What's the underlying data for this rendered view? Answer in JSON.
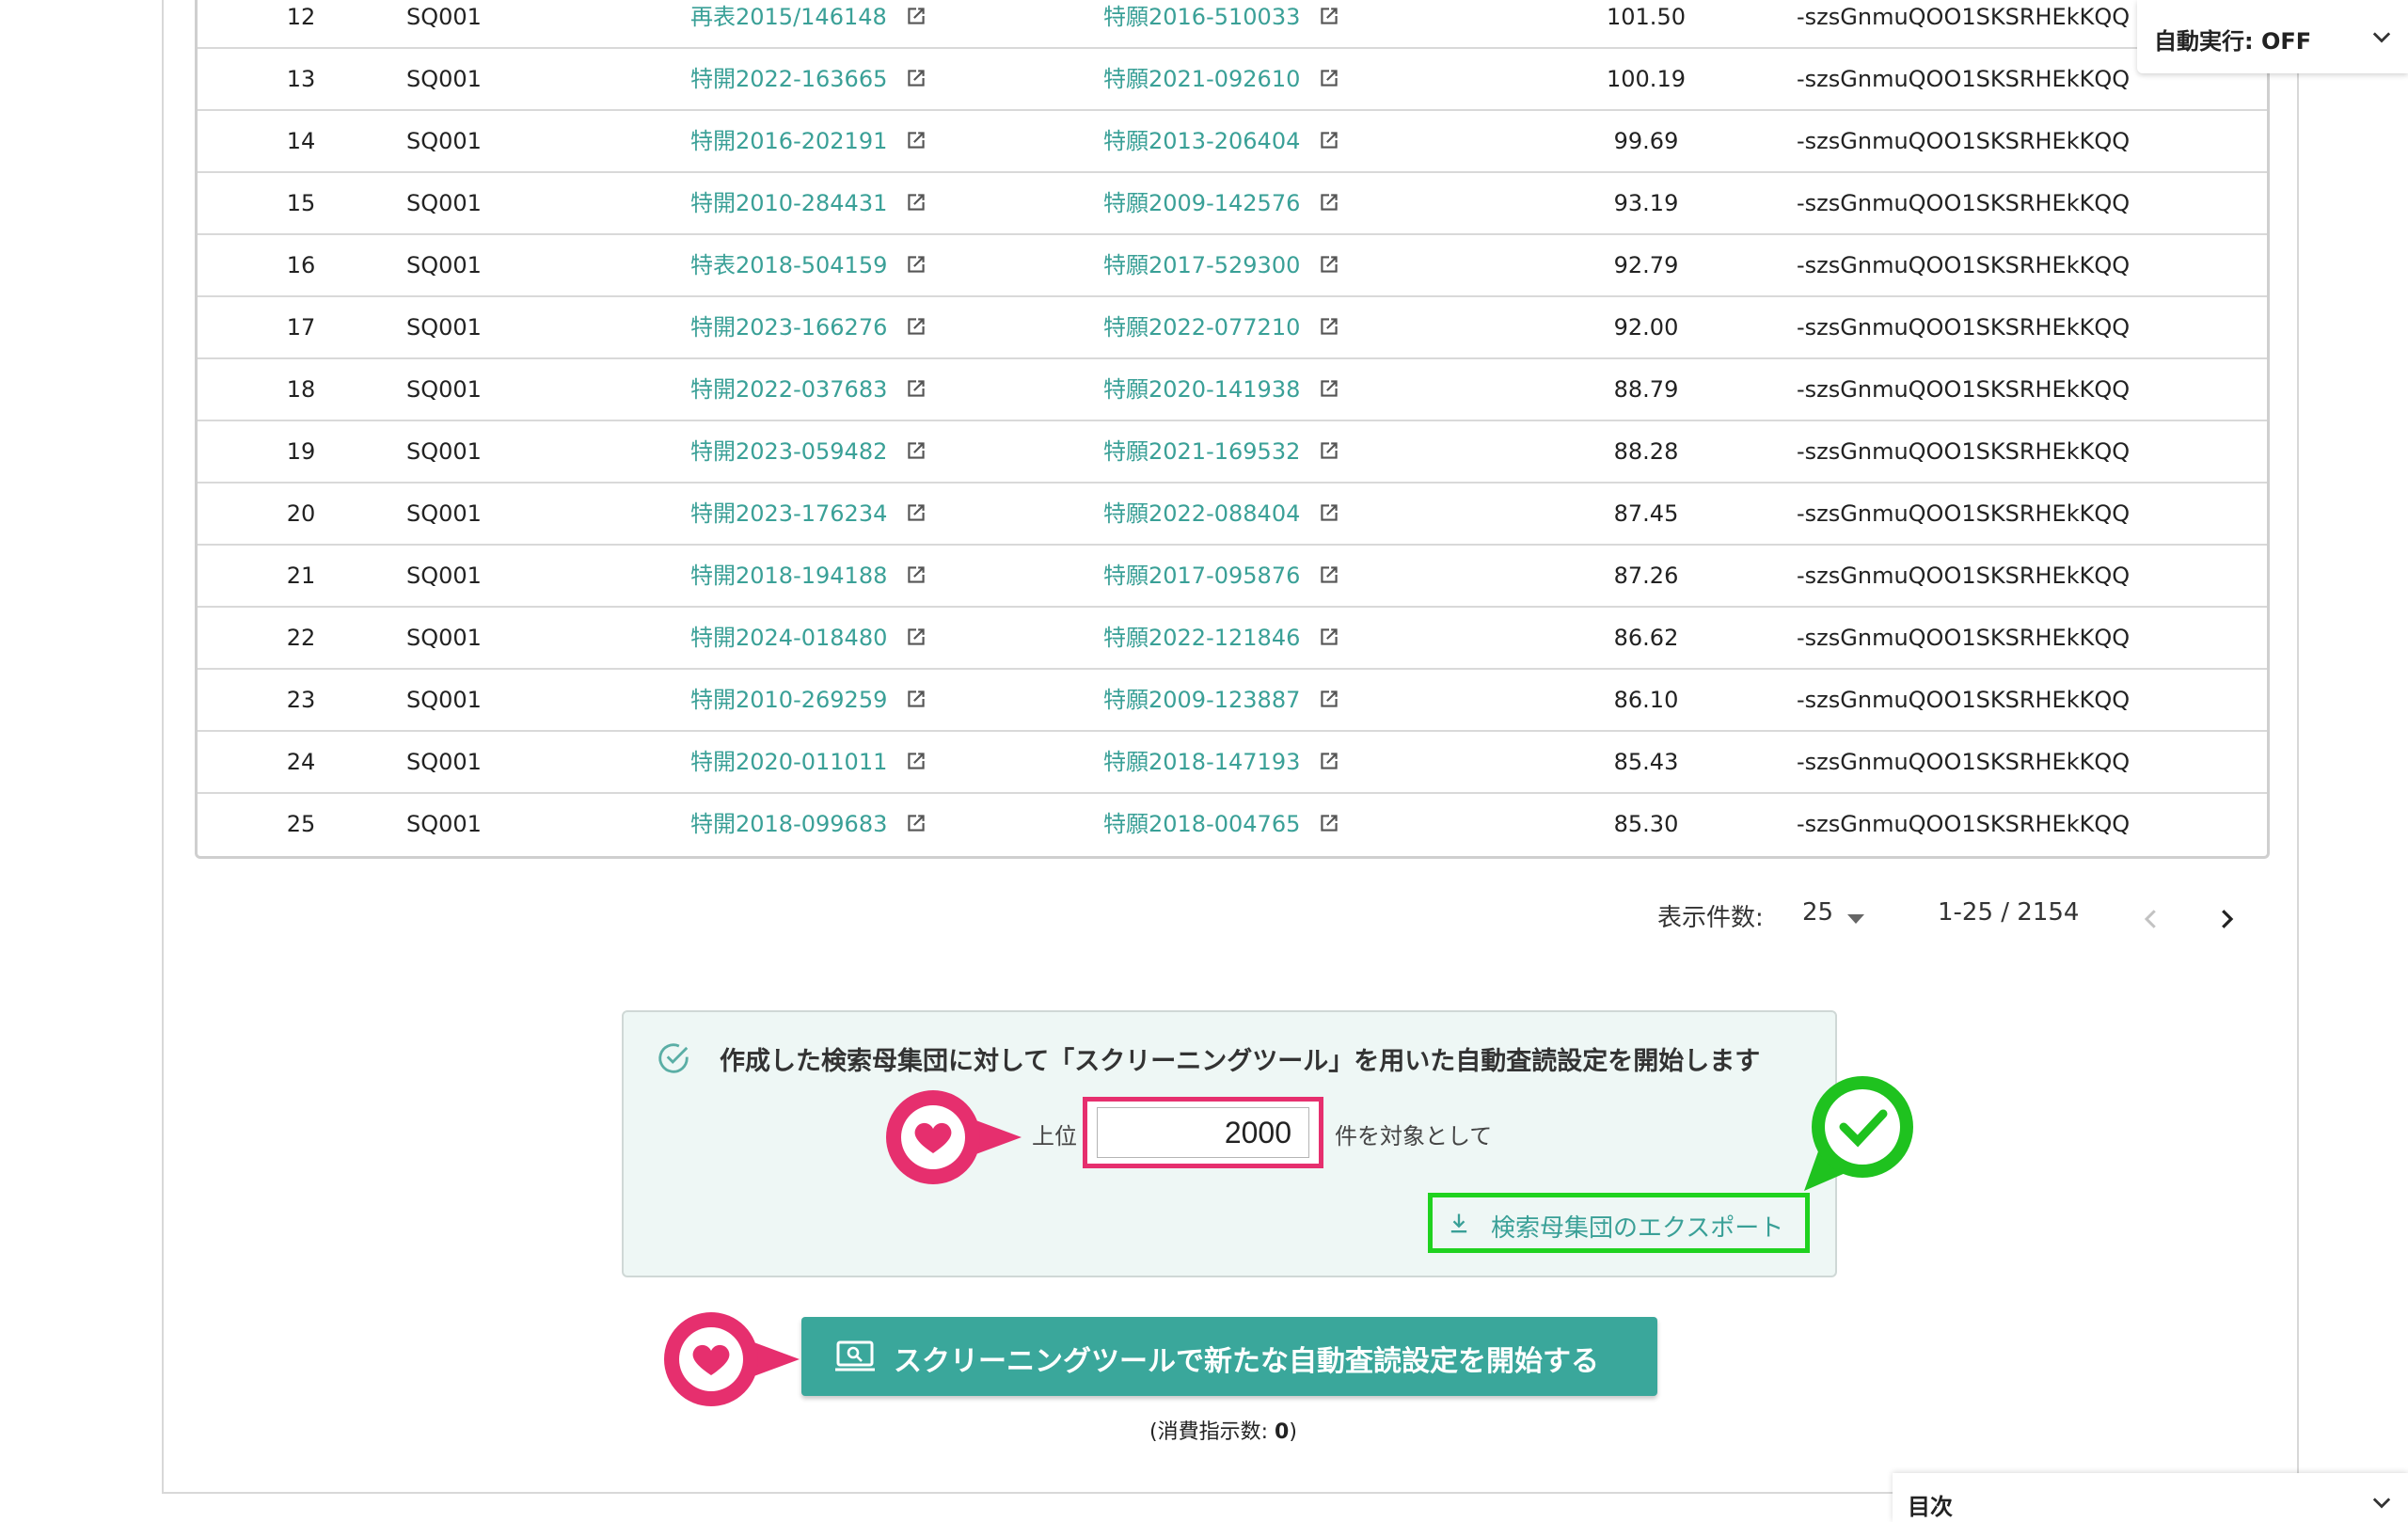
{
  "auto_run": {
    "label": "自動実行: OFF"
  },
  "table": {
    "rows": [
      {
        "no": "12",
        "sq": "SQ001",
        "pub": "再表2015/146148",
        "app": "特願2016-510033",
        "score": "101.50",
        "id": "-szsGnmuQOO1SKSRHEkKQQ"
      },
      {
        "no": "13",
        "sq": "SQ001",
        "pub": "特開2022-163665",
        "app": "特願2021-092610",
        "score": "100.19",
        "id": "-szsGnmuQOO1SKSRHEkKQQ"
      },
      {
        "no": "14",
        "sq": "SQ001",
        "pub": "特開2016-202191",
        "app": "特願2013-206404",
        "score": "99.69",
        "id": "-szsGnmuQOO1SKSRHEkKQQ"
      },
      {
        "no": "15",
        "sq": "SQ001",
        "pub": "特開2010-284431",
        "app": "特願2009-142576",
        "score": "93.19",
        "id": "-szsGnmuQOO1SKSRHEkKQQ"
      },
      {
        "no": "16",
        "sq": "SQ001",
        "pub": "特表2018-504159",
        "app": "特願2017-529300",
        "score": "92.79",
        "id": "-szsGnmuQOO1SKSRHEkKQQ"
      },
      {
        "no": "17",
        "sq": "SQ001",
        "pub": "特開2023-166276",
        "app": "特願2022-077210",
        "score": "92.00",
        "id": "-szsGnmuQOO1SKSRHEkKQQ"
      },
      {
        "no": "18",
        "sq": "SQ001",
        "pub": "特開2022-037683",
        "app": "特願2020-141938",
        "score": "88.79",
        "id": "-szsGnmuQOO1SKSRHEkKQQ"
      },
      {
        "no": "19",
        "sq": "SQ001",
        "pub": "特開2023-059482",
        "app": "特願2021-169532",
        "score": "88.28",
        "id": "-szsGnmuQOO1SKSRHEkKQQ"
      },
      {
        "no": "20",
        "sq": "SQ001",
        "pub": "特開2023-176234",
        "app": "特願2022-088404",
        "score": "87.45",
        "id": "-szsGnmuQOO1SKSRHEkKQQ"
      },
      {
        "no": "21",
        "sq": "SQ001",
        "pub": "特開2018-194188",
        "app": "特願2017-095876",
        "score": "87.26",
        "id": "-szsGnmuQOO1SKSRHEkKQQ"
      },
      {
        "no": "22",
        "sq": "SQ001",
        "pub": "特開2024-018480",
        "app": "特願2022-121846",
        "score": "86.62",
        "id": "-szsGnmuQOO1SKSRHEkKQQ"
      },
      {
        "no": "23",
        "sq": "SQ001",
        "pub": "特開2010-269259",
        "app": "特願2009-123887",
        "score": "86.10",
        "id": "-szsGnmuQOO1SKSRHEkKQQ"
      },
      {
        "no": "24",
        "sq": "SQ001",
        "pub": "特開2020-011011",
        "app": "特願2018-147193",
        "score": "85.43",
        "id": "-szsGnmuQOO1SKSRHEkKQQ"
      },
      {
        "no": "25",
        "sq": "SQ001",
        "pub": "特開2018-099683",
        "app": "特願2018-004765",
        "score": "85.30",
        "id": "-szsGnmuQOO1SKSRHEkKQQ"
      }
    ]
  },
  "pagination": {
    "per_page_label": "表示件数:",
    "per_page_value": "25",
    "range": "1-25 / 2154"
  },
  "screening": {
    "title": "作成した検索母集団に対して「スクリーニングツール」を用いた自動査読設定を開始します",
    "top_label": "上位",
    "count_value": "2000",
    "suffix_label": "件を対象として",
    "export_label": "検索母集団のエクスポート"
  },
  "start_button": {
    "label": "スクリーニングツールで新たな自動査読設定を開始する"
  },
  "consumption": {
    "prefix": "(消費指示数: ",
    "value": "0",
    "suffix": ")"
  },
  "toc": {
    "label": "目次"
  },
  "colors": {
    "accent": "#3aa79b",
    "link": "#3aa097",
    "highlight_pink": "#e62f6e",
    "highlight_green": "#1fd21f"
  }
}
